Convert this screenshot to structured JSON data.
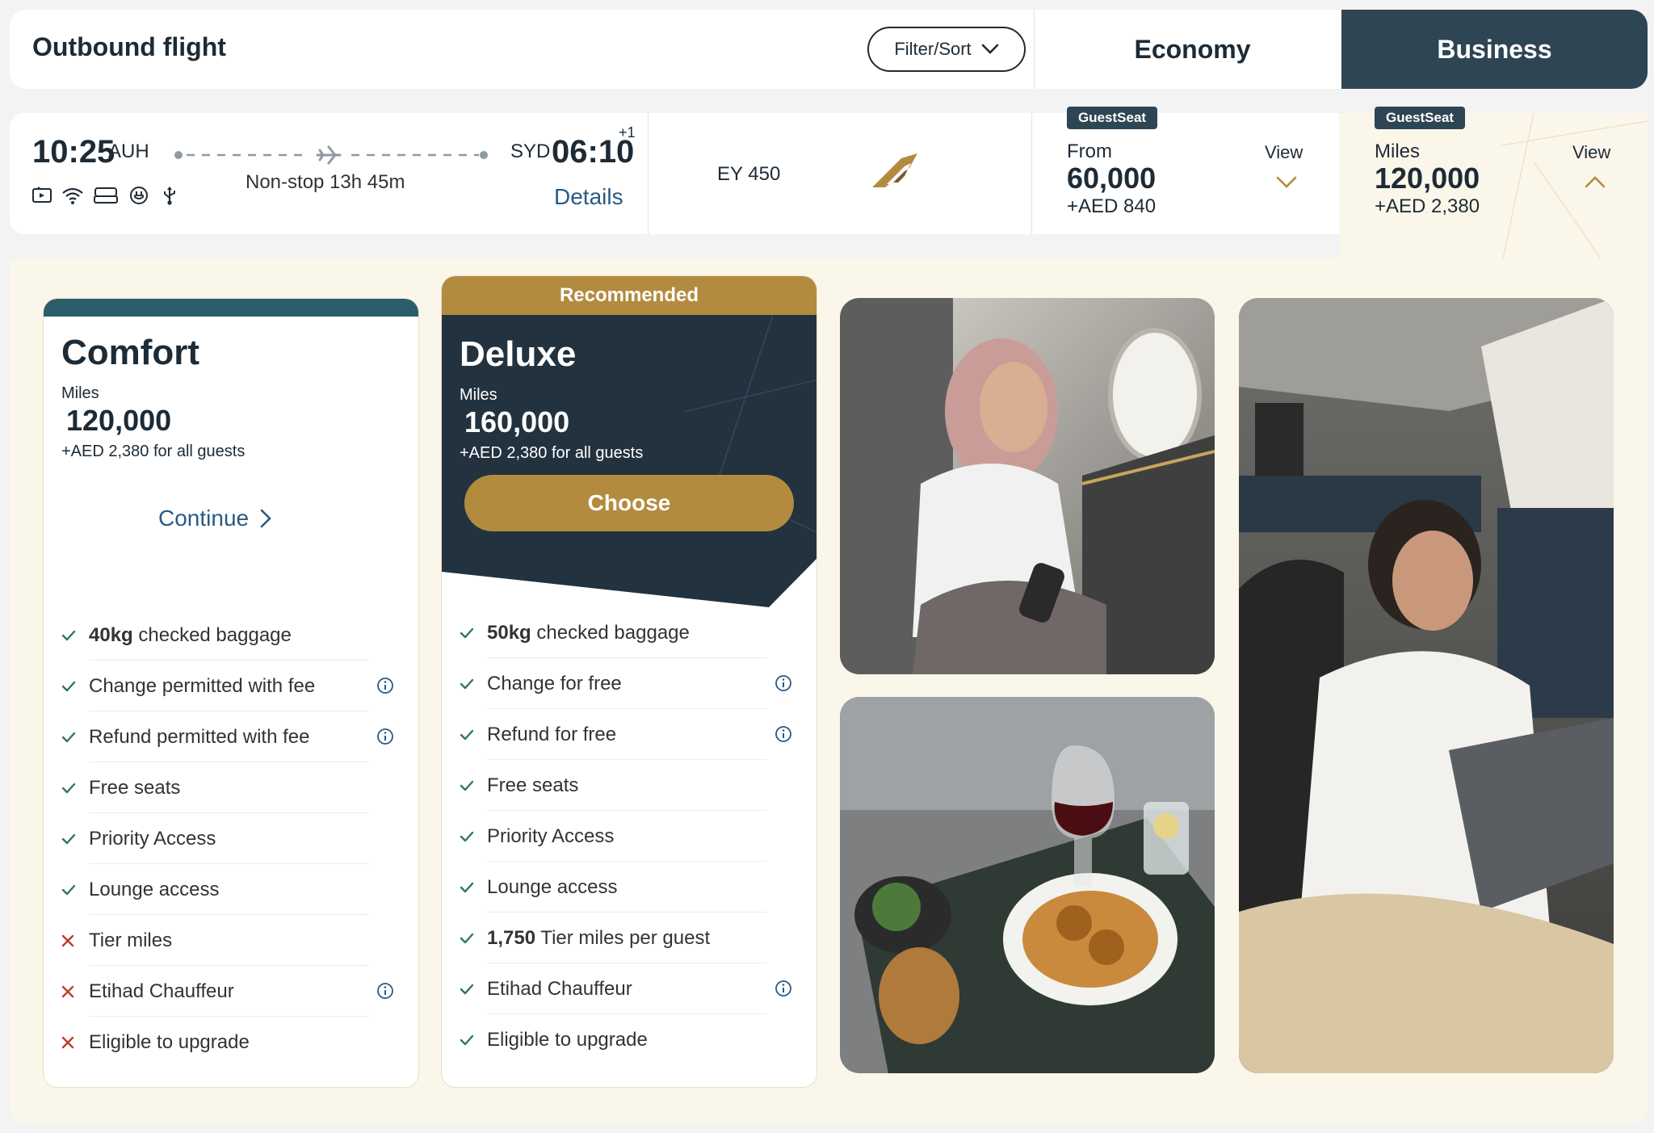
{
  "header": {
    "title": "Outbound flight",
    "filter_label": "Filter/Sort",
    "tabs": [
      {
        "label": "Economy"
      },
      {
        "label": "Business"
      }
    ],
    "active_tab": "Business"
  },
  "flight": {
    "departure_time": "10:25",
    "departure_code": "AUH",
    "arrival_time": "06:10",
    "arrival_code": "SYD",
    "day_offset": "+1",
    "duration": "Non-stop 13h 45m",
    "details_label": "Details",
    "flight_number": "EY 450",
    "amenity_icons": [
      "tv-icon",
      "wifi-icon",
      "seat-icon",
      "power-icon",
      "usb-icon"
    ]
  },
  "fares": {
    "economy": {
      "badge": "GuestSeat",
      "label": "From",
      "miles": "60,000",
      "aed": "+AED 840",
      "view": "View"
    },
    "business": {
      "badge": "GuestSeat",
      "label": "Miles",
      "miles": "120,000",
      "aed": "+AED 2,380",
      "view": "View"
    }
  },
  "plans": [
    {
      "name": "Comfort",
      "miles_label": "Miles",
      "miles": "120,000",
      "aed": "+AED 2,380 for all guests",
      "action": "Continue",
      "features": [
        {
          "bold": "40kg",
          "text": " checked baggage",
          "ok": true,
          "info": false
        },
        {
          "bold": "",
          "text": "Change permitted with fee",
          "ok": true,
          "info": true
        },
        {
          "bold": "",
          "text": "Refund permitted with fee",
          "ok": true,
          "info": true
        },
        {
          "bold": "",
          "text": "Free seats",
          "ok": true,
          "info": false
        },
        {
          "bold": "",
          "text": "Priority Access",
          "ok": true,
          "info": false
        },
        {
          "bold": "",
          "text": "Lounge access",
          "ok": true,
          "info": false
        },
        {
          "bold": "",
          "text": "Tier miles",
          "ok": false,
          "info": false
        },
        {
          "bold": "",
          "text": "Etihad Chauffeur",
          "ok": false,
          "info": true
        },
        {
          "bold": "",
          "text": "Eligible to upgrade",
          "ok": false,
          "info": false
        }
      ]
    },
    {
      "name": "Deluxe",
      "banner": "Recommended",
      "miles_label": "Miles",
      "miles": "160,000",
      "aed": "+AED 2,380 for all guests",
      "action": "Choose",
      "features": [
        {
          "bold": "50kg",
          "text": " checked baggage",
          "ok": true,
          "info": false
        },
        {
          "bold": "",
          "text": "Change for free",
          "ok": true,
          "info": true
        },
        {
          "bold": "",
          "text": "Refund for free",
          "ok": true,
          "info": true
        },
        {
          "bold": "",
          "text": "Free seats",
          "ok": true,
          "info": false
        },
        {
          "bold": "",
          "text": "Priority Access",
          "ok": true,
          "info": false
        },
        {
          "bold": "",
          "text": "Lounge access",
          "ok": true,
          "info": false
        },
        {
          "bold": "1,750",
          "text": " Tier miles per guest",
          "ok": true,
          "info": false
        },
        {
          "bold": "",
          "text": "Etihad Chauffeur",
          "ok": true,
          "info": true
        },
        {
          "bold": "",
          "text": "Eligible to upgrade",
          "ok": true,
          "info": false
        }
      ]
    }
  ],
  "colors": {
    "navy": "#2e4553",
    "gold": "#b38b3f",
    "teal": "#2a5e6a",
    "link": "#2a5a85",
    "check": "#2f7a4f",
    "cross": "#c0392b",
    "cream": "#fbf6ea"
  }
}
